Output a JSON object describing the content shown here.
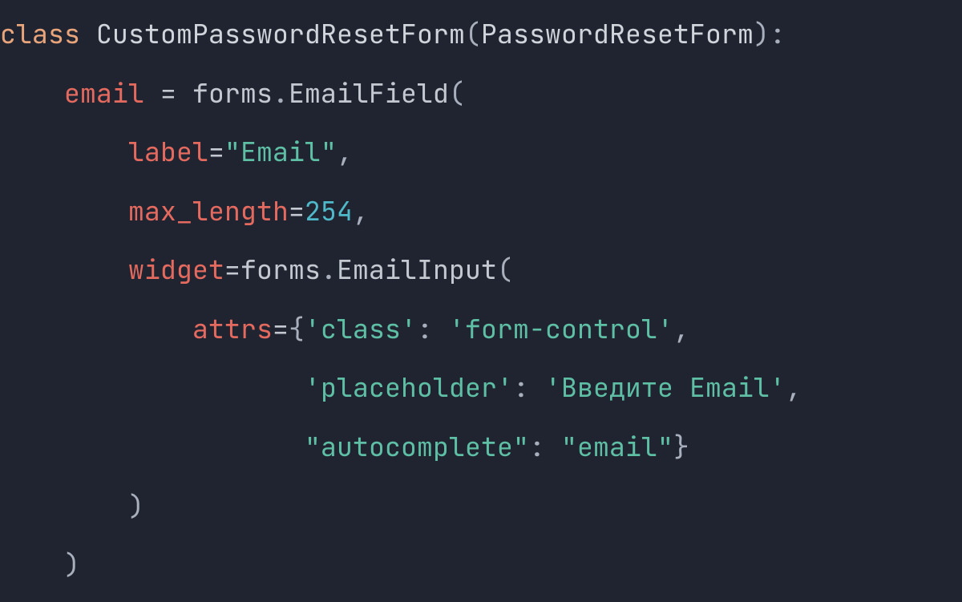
{
  "code": {
    "line1": {
      "kw_class": "class",
      "sp1": " ",
      "classname": "CustomPasswordResetForm",
      "paren_open": "(",
      "base": "PasswordResetForm",
      "paren_close_colon": "):"
    },
    "line2": {
      "indent": "    ",
      "field": "email",
      "eq": " = ",
      "mod": "forms",
      "dot": ".",
      "call": "EmailField",
      "paren": "("
    },
    "line3": {
      "indent1": "        ",
      "kw": "label",
      "eq": "=",
      "str": "\"Email\"",
      "comma": ","
    },
    "line4": {
      "indent1": "        ",
      "kw": "max_length",
      "eq": "=",
      "num": "254",
      "comma": ","
    },
    "line5": {
      "indent1": "        ",
      "kw": "widget",
      "eq": "=",
      "mod": "forms",
      "dot": ".",
      "call": "EmailInput",
      "paren": "("
    },
    "line6": {
      "indent1": "            ",
      "kw": "attrs",
      "eq": "=",
      "brace": "{",
      "k1": "'class'",
      "colon1": ": ",
      "v1": "'form-control'",
      "comma": ","
    },
    "line7": {
      "indent1": "                   ",
      "k2": "'placeholder'",
      "colon2": ": ",
      "v2": "'Введите Email'",
      "comma": ","
    },
    "line8": {
      "indent1": "                   ",
      "k3": "\"autocomplete\"",
      "colon3": ": ",
      "v3": "\"email\"",
      "brace_close": "}"
    },
    "line9": {
      "indent1": "        ",
      "paren": ")"
    },
    "line10": {
      "indent": "    ",
      "paren": ")"
    }
  }
}
